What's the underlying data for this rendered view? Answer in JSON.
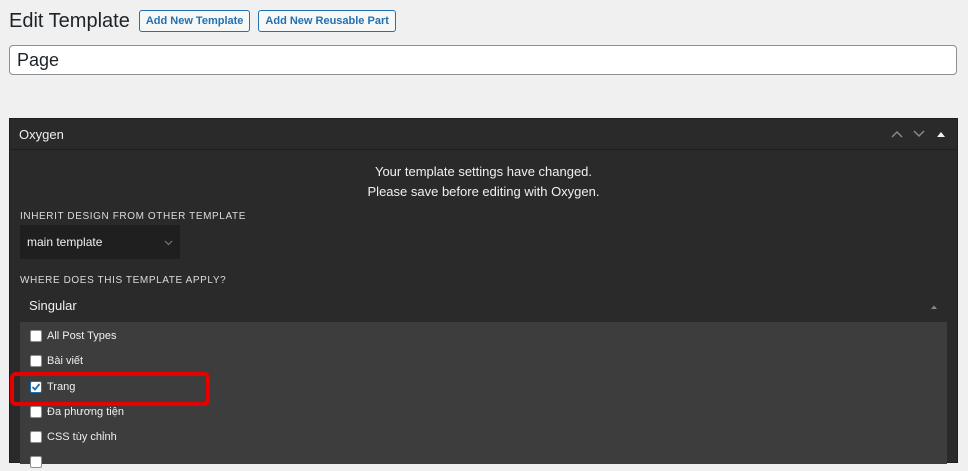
{
  "header": {
    "title": "Edit Template",
    "add_template_label": "Add New Template",
    "add_part_label": "Add New Reusable Part"
  },
  "title_field": {
    "value": "Page"
  },
  "panel": {
    "title": "Oxygen",
    "notice_line1": "Your template settings have changed.",
    "notice_line2": "Please save before editing with Oxygen.",
    "inherit_label": "INHERIT DESIGN FROM OTHER TEMPLATE",
    "inherit_value": "main template",
    "apply_label": "WHERE DOES THIS TEMPLATE APPLY?",
    "accordion_title": "Singular",
    "items": [
      {
        "label": "All Post Types",
        "checked": false
      },
      {
        "label": "Bài viết",
        "checked": false
      },
      {
        "label": "Trang",
        "checked": true
      },
      {
        "label": "Đa phương tiện",
        "checked": false
      },
      {
        "label": "CSS tùy chỉnh",
        "checked": false
      }
    ]
  },
  "colors": {
    "accent": "#2271b1",
    "panel_bg": "#2a2a2a",
    "list_bg": "#3d3d3d",
    "highlight": "#e60000"
  }
}
